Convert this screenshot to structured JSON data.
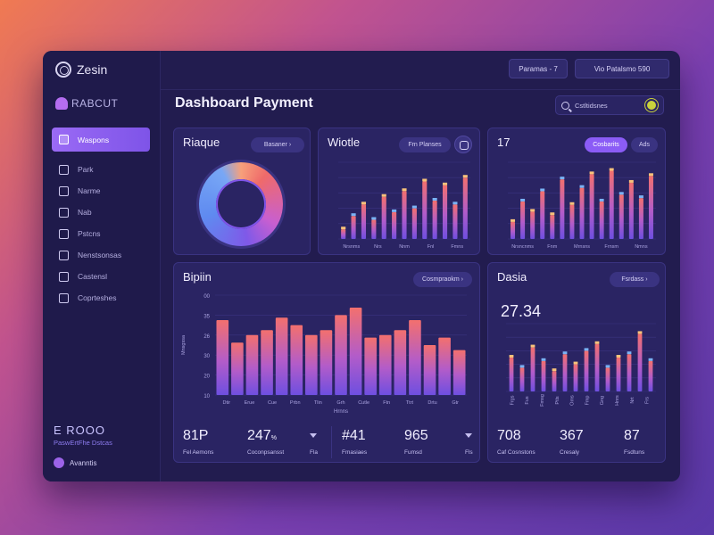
{
  "app": {
    "name": "Zesin",
    "workspace": "RABCUT"
  },
  "topbar": {
    "btn1": "Paramas - 7",
    "btn2": "Vio Patalsmo 590"
  },
  "sidebar": {
    "items": [
      {
        "label": "Waspons",
        "icon": "grid-icon"
      },
      {
        "label": "Park",
        "icon": "car-icon"
      },
      {
        "label": "Narme",
        "icon": "box-icon"
      },
      {
        "label": "Nab",
        "icon": "tag-icon"
      },
      {
        "label": "Pstcns",
        "icon": "folder-icon"
      },
      {
        "label": "Nenstsonsas",
        "icon": "user-icon"
      },
      {
        "label": "Castensl",
        "icon": "monitor-icon"
      },
      {
        "label": "Coprteshes",
        "icon": "people-icon"
      }
    ],
    "footer": {
      "brand": "E ROOO",
      "sub": "PaswErtFhe Dstcas",
      "user": "Avanntis"
    }
  },
  "main": {
    "title": "Dashboard Payment",
    "search_placeholder": "Cstltidsnes"
  },
  "cards": {
    "donut": {
      "title": "Riaque",
      "pill": "Basaner ›"
    },
    "wiotle": {
      "title": "Wiotle",
      "pill": "Frn Planses",
      "bar_labels": [
        "Nrsnms",
        "Nrs",
        "Nnm",
        "Fnl",
        "Fmns"
      ]
    },
    "small17": {
      "title": "17",
      "pill1": "Cosbarits",
      "pill2": "Ads",
      "bar_labels": [
        "Nrsncnms",
        "Fnm",
        "Mrnsns",
        "Frnsm",
        "Nmns"
      ]
    },
    "bigbar": {
      "title": "Bipiin",
      "pill": "Cosmpraokm ›",
      "y_ticks": [
        "00",
        "35",
        "26",
        "30",
        "20",
        "10"
      ],
      "y_label": "Mnsgssa",
      "x_labels": [
        "Dtir",
        "Erue",
        "Cue",
        "Prbn",
        "Tlin",
        "Grh",
        "Cutle",
        "Ftn",
        "Ttrt",
        "Drtu",
        "Gtr"
      ],
      "x_axis_label": "Hrnns"
    },
    "dasia": {
      "title": "Dasia",
      "pill": "Fsrdass ›",
      "big_value": "27.34",
      "x_labels": [
        "Frgs",
        "Fus",
        "Fmsg",
        "Ptls",
        "Oms",
        "Fmp",
        "Gng",
        "Hnrs",
        "Nrt",
        "Frs"
      ]
    }
  },
  "stats": [
    {
      "value": "81P",
      "label": "Fel Aemons"
    },
    {
      "value": "247",
      "label": "Coconpsansst",
      "suffix": "%"
    },
    {
      "value": "",
      "label": "Fla"
    },
    {
      "value": "#41",
      "label": "Fmasiaes"
    },
    {
      "value": "965",
      "label": "Fumsd"
    },
    {
      "value": "",
      "label": "Fls"
    },
    {
      "value": "708",
      "label": "Caf Cosnstons"
    },
    {
      "value": "367",
      "label": "Cresaly"
    },
    {
      "value": "87",
      "label": "Fsdtuns"
    }
  ],
  "colors": {
    "accent": "#8b5cf6",
    "bar_top": "#f3706e",
    "bar_bottom": "#6e4fe0",
    "panel": "#2a2463",
    "bg": "#221c4f"
  },
  "chart_data": [
    {
      "type": "bar",
      "title": "Bipiin",
      "categories": [
        "Dtir",
        "Erue",
        "Cue",
        "Prbn",
        "Tlin",
        "Grh",
        "Cutle",
        "Ftn",
        "Ttrt",
        "Drtu",
        "Gtr"
      ],
      "series": [
        {
          "values": [
            30,
            21,
            24,
            26,
            31,
            28,
            24,
            26,
            32,
            35,
            23,
            24,
            26,
            30,
            20,
            23,
            18
          ]
        }
      ],
      "ylim": [
        0,
        40
      ]
    },
    {
      "type": "bar",
      "title": "Wiotle",
      "series": [
        {
          "values": [
            5,
            12,
            18,
            10,
            22,
            14,
            25,
            16,
            30,
            20,
            28,
            18,
            32
          ]
        }
      ],
      "ylim": [
        0,
        40
      ]
    },
    {
      "type": "bar",
      "title": "17",
      "series": [
        {
          "values": [
            10,
            22,
            16,
            28,
            14,
            35,
            20,
            30,
            38,
            22,
            40,
            26,
            33,
            24,
            37
          ]
        }
      ],
      "ylim": [
        0,
        45
      ]
    },
    {
      "type": "bar",
      "title": "Dasia",
      "series": [
        {
          "values": [
            20,
            14,
            26,
            18,
            12,
            22,
            16,
            24,
            28,
            14,
            20,
            22,
            34,
            18
          ]
        }
      ],
      "ylim": [
        0,
        40
      ]
    },
    {
      "type": "pie",
      "title": "Riaque",
      "values": [
        0.12,
        0.18,
        0.15,
        0.23,
        0.22,
        0.1
      ]
    }
  ]
}
